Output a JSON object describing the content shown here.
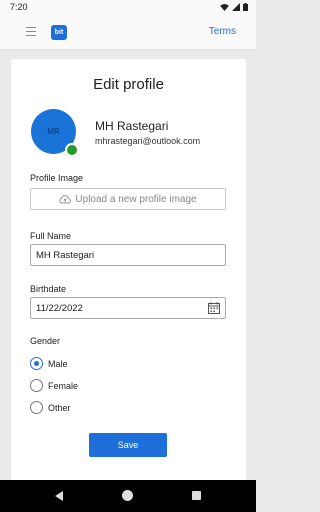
{
  "status_bar": {
    "time": "7:20"
  },
  "app_bar": {
    "logo_text": "bit",
    "terms_label": "Terms"
  },
  "profile": {
    "title": "Edit profile",
    "avatar_initials": "MR",
    "name": "MH Rastegari",
    "email": "mhrastegari@outlook.com"
  },
  "form": {
    "profile_image_label": "Profile Image",
    "upload_label": "Upload a new profile image",
    "full_name_label": "Full Name",
    "full_name_value": "MH Rastegari",
    "birthdate_label": "Birthdate",
    "birthdate_value": "11/22/2022",
    "gender_label": "Gender",
    "gender_options": [
      "Male",
      "Female",
      "Other"
    ],
    "gender_selected": "Male",
    "save_label": "Save"
  },
  "colors": {
    "accent": "#1e6fd9",
    "presence": "#1e9e2f",
    "background": "#eaeaea"
  },
  "icons": [
    "menu-icon",
    "cloud-upload-icon",
    "calendar-icon",
    "wifi-icon",
    "signal-icon",
    "battery-icon"
  ]
}
